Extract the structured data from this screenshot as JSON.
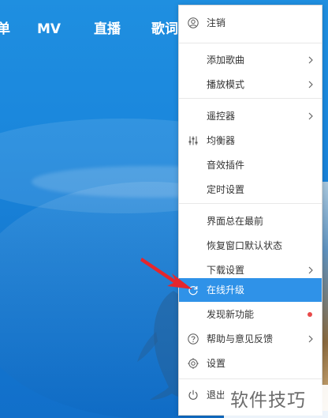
{
  "top_nav": {
    "items": [
      "单",
      "MV",
      "直播",
      "歌词"
    ]
  },
  "context_menu": {
    "items": [
      {
        "label": "注销",
        "icon": "user-icon"
      },
      {
        "label": "添加歌曲",
        "has_submenu": true
      },
      {
        "label": "播放模式",
        "has_submenu": true
      },
      {
        "label": "遥控器",
        "has_submenu": true
      },
      {
        "label": "均衡器",
        "icon": "equalizer-icon"
      },
      {
        "label": "音效插件"
      },
      {
        "label": "定时设置"
      },
      {
        "label": "界面总在最前"
      },
      {
        "label": "恢复窗口默认状态"
      },
      {
        "label": "下载设置",
        "has_submenu": true
      },
      {
        "label": "在线升级",
        "icon": "refresh-icon",
        "highlighted": true
      },
      {
        "label": "发现新功能",
        "badge": "red-dot"
      },
      {
        "label": "帮助与意见反馈",
        "icon": "help-icon",
        "has_submenu": true
      },
      {
        "label": "设置",
        "icon": "gear-icon"
      },
      {
        "label": "退出",
        "icon": "power-icon"
      }
    ]
  },
  "watermark": {
    "text": "软件技巧"
  },
  "colors": {
    "background_blue": "#1a86dc",
    "highlight_blue": "#2f92e8",
    "badge_red": "#e84a4a",
    "pointer_red": "#e5262d"
  }
}
